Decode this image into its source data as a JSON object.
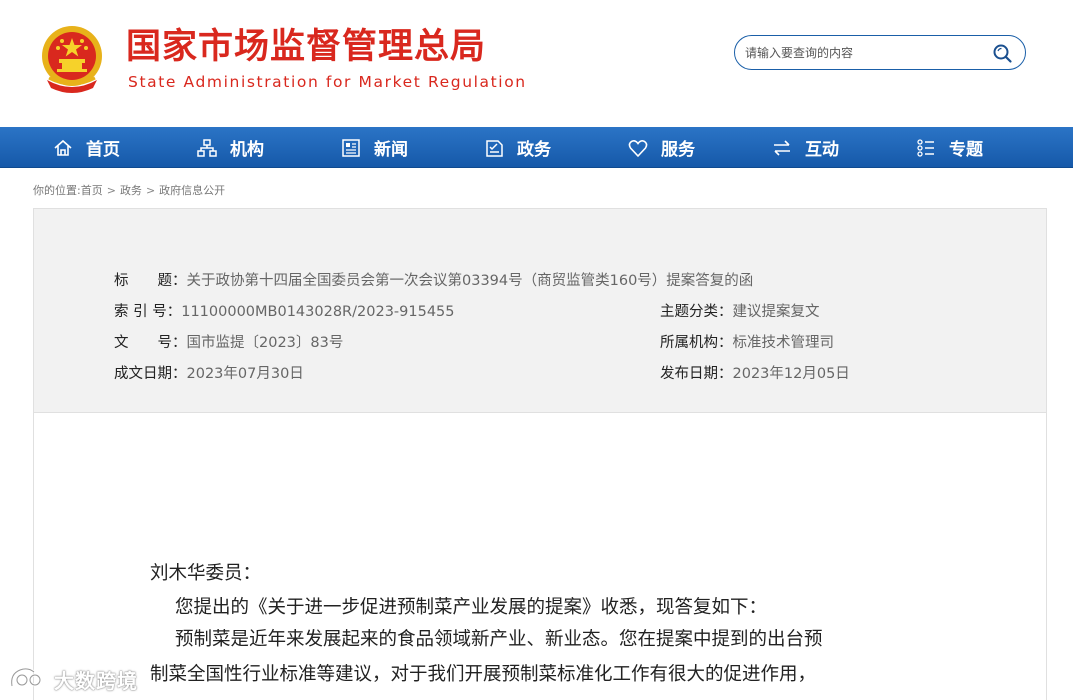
{
  "header": {
    "title": "国家市场监督管理总局",
    "subtitle": "State Administration for Market Regulation",
    "search_placeholder": "请输入要查询的内容"
  },
  "nav": {
    "items": [
      {
        "label": "首页",
        "icon": "home-icon"
      },
      {
        "label": "机构",
        "icon": "org-chart-icon"
      },
      {
        "label": "新闻",
        "icon": "newspaper-icon"
      },
      {
        "label": "政务",
        "icon": "document-icon"
      },
      {
        "label": "服务",
        "icon": "heart-icon"
      },
      {
        "label": "互动",
        "icon": "exchange-arrows-icon"
      },
      {
        "label": "专题",
        "icon": "list-icon"
      }
    ]
  },
  "breadcrumb": {
    "prefix": "你的位置:",
    "items": [
      "首页",
      "政务",
      "政府信息公开"
    ],
    "separator": ">"
  },
  "info": {
    "title_label": "标　　题：",
    "title_value": "关于政协第十四届全国委员会第一次会议第03394号（商贸监管类160号）提案答复的函",
    "index_label": "索 引 号：",
    "index_value": "11100000MB0143028R/2023-915455",
    "topic_label": "主题分类：",
    "topic_value": "建议提案复文",
    "doc_label": "文　　号：",
    "doc_value": "国市监提〔2023〕83号",
    "org_label": "所属机构：",
    "org_value": "标准技术管理司",
    "created_label": "成文日期：",
    "created_value": "2023年07月30日",
    "published_label": "发布日期：",
    "published_value": "2023年12月05日"
  },
  "content": {
    "salutation": "刘木华委员：",
    "para1": "您提出的《关于进一步促进预制菜产业发展的提案》收悉，现答复如下：",
    "para2_line1": "预制菜是近年来发展起来的食品领域新产业、新业态。您在提案中提到的出台预",
    "para2_line2": "制菜全国性行业标准等建议，对于我们开展预制菜标准化工作有很大的促进作用，"
  },
  "watermark": {
    "text": "大数跨境"
  },
  "colors": {
    "brand_red": "#d9281e",
    "nav_blue": "#1c62b3",
    "panel_gray": "#f2f2f2"
  }
}
